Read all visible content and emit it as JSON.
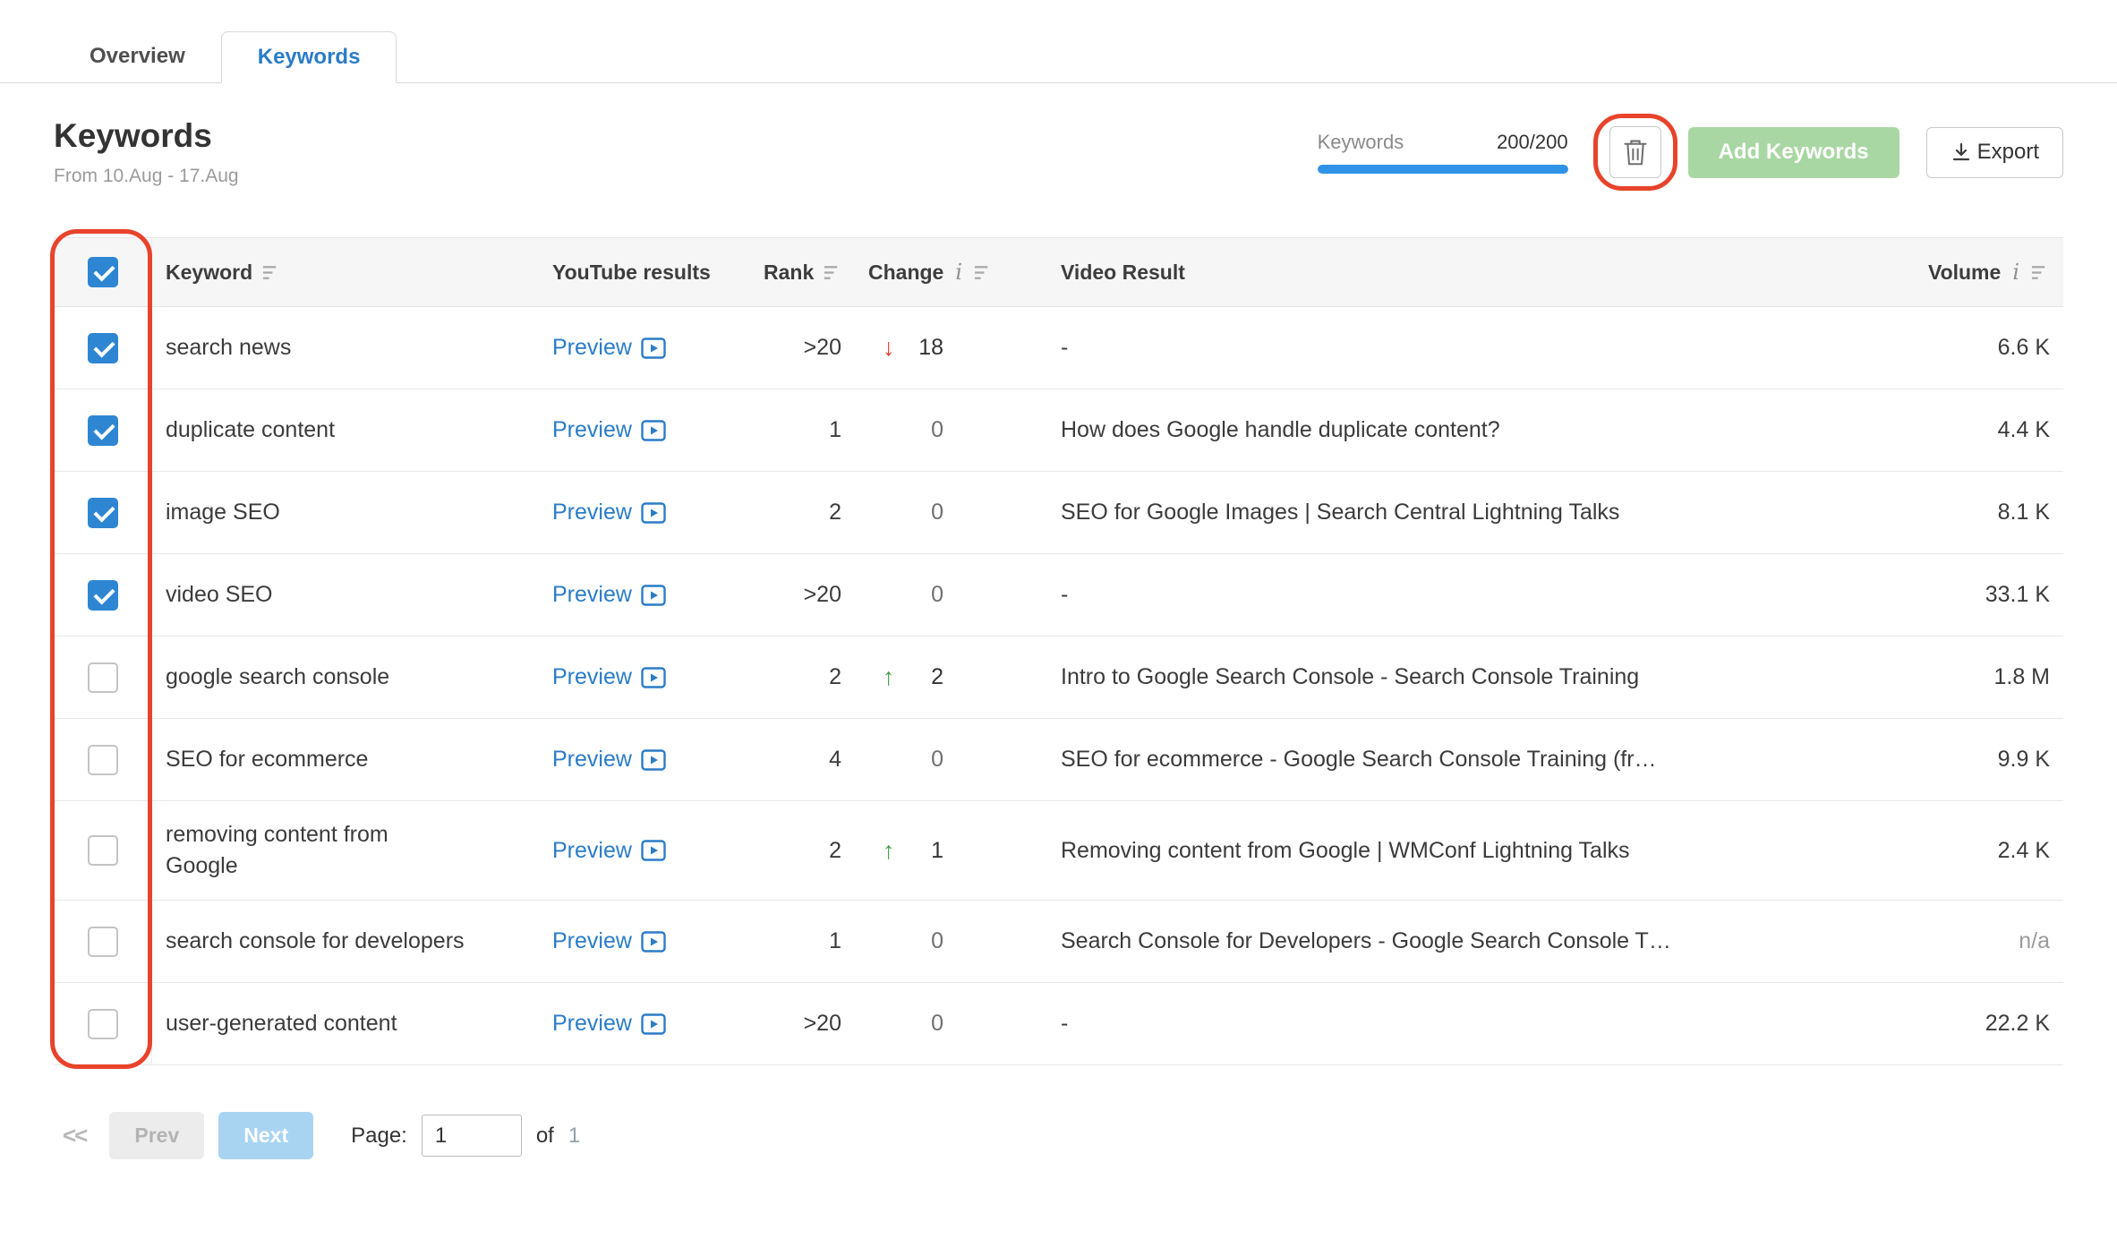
{
  "tabs": [
    {
      "label": "Overview",
      "active": false
    },
    {
      "label": "Keywords",
      "active": true
    }
  ],
  "header": {
    "title": "Keywords",
    "date_range": "From 10.Aug - 17.Aug",
    "keywords_counter": {
      "label": "Keywords",
      "value": "200/200",
      "progress_pct": 100
    },
    "add_keywords_label": "Add Keywords",
    "export_label": "Export"
  },
  "table": {
    "select_all_checked": true,
    "columns": [
      "Keyword",
      "YouTube results",
      "Rank",
      "Change",
      "Video Result",
      "Volume"
    ],
    "preview_label": "Preview",
    "rows": [
      {
        "checked": true,
        "keyword": "search news",
        "rank": ">20",
        "change": "18",
        "change_dir": "down",
        "video_result": "-",
        "volume": "6.6 K"
      },
      {
        "checked": true,
        "keyword": "duplicate content",
        "rank": "1",
        "change": "0",
        "change_dir": "none",
        "video_result": "How does Google handle duplicate content?",
        "volume": "4.4 K"
      },
      {
        "checked": true,
        "keyword": "image SEO",
        "rank": "2",
        "change": "0",
        "change_dir": "none",
        "video_result": "SEO for Google Images | Search Central Lightning Talks",
        "volume": "8.1 K"
      },
      {
        "checked": true,
        "keyword": "video SEO",
        "rank": ">20",
        "change": "0",
        "change_dir": "none",
        "video_result": "-",
        "volume": "33.1 K"
      },
      {
        "checked": false,
        "keyword": "google search console",
        "rank": "2",
        "change": "2",
        "change_dir": "up",
        "video_result": "Intro to Google Search Console - Search Console Training",
        "volume": "1.8 M"
      },
      {
        "checked": false,
        "keyword": "SEO for ecommerce",
        "rank": "4",
        "change": "0",
        "change_dir": "none",
        "video_result": "SEO for ecommerce - Google Search Console Training (fr…",
        "volume": "9.9 K"
      },
      {
        "checked": false,
        "keyword": "removing content from\nGoogle",
        "rank": "2",
        "change": "1",
        "change_dir": "up",
        "video_result": "Removing content from Google | WMConf Lightning Talks",
        "volume": "2.4 K"
      },
      {
        "checked": false,
        "keyword": "search console for developers",
        "rank": "1",
        "change": "0",
        "change_dir": "none",
        "video_result": "Search Console for Developers - Google Search Console T…",
        "volume": "n/a"
      },
      {
        "checked": false,
        "keyword": "user-generated content",
        "rank": ">20",
        "change": "0",
        "change_dir": "none",
        "video_result": "-",
        "volume": "22.2 K"
      }
    ]
  },
  "pagination": {
    "first_label": "<<",
    "prev_label": "Prev",
    "next_label": "Next",
    "page_label": "Page:",
    "page_value": "1",
    "of_label": "of",
    "total_pages": "1"
  },
  "colors": {
    "accent_blue": "#2a7cc7",
    "progress_blue": "#2f93e8",
    "checkbox_blue": "#2e86d2",
    "up_green": "#3f9e46",
    "down_red": "#e0402f",
    "add_button_green": "#a9d7a3",
    "next_button_blue": "#a8d4f2",
    "annotation_red": "#e8432b"
  }
}
